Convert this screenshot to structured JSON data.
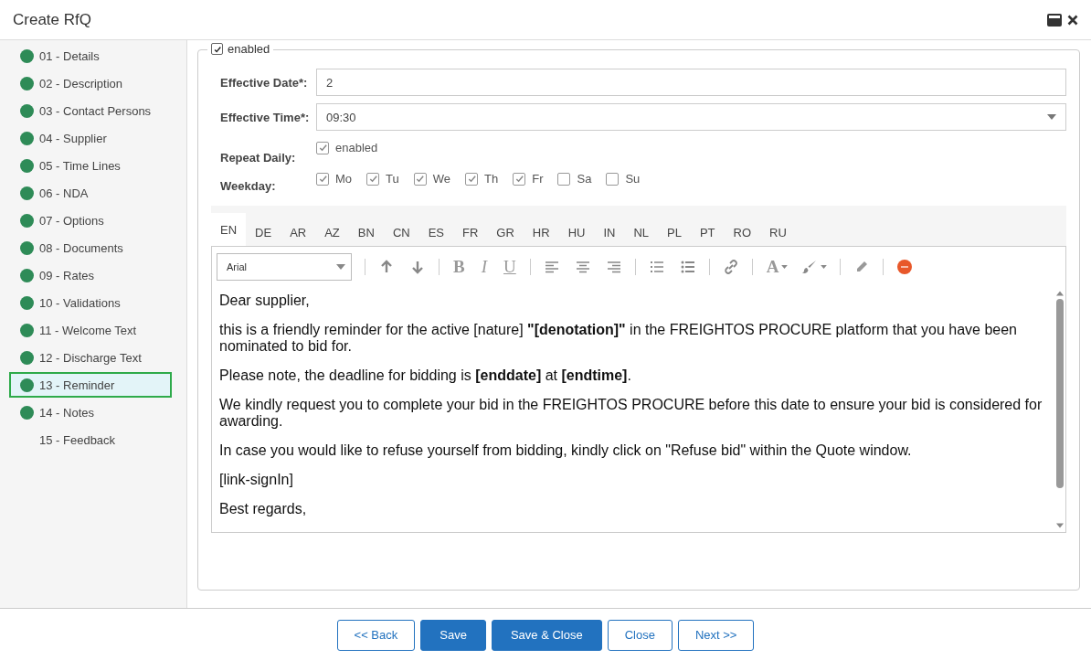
{
  "window": {
    "title": "Create RfQ"
  },
  "sidebar": {
    "items": [
      {
        "label": "01 - Details",
        "done": true,
        "selected": false
      },
      {
        "label": "02 - Description",
        "done": true,
        "selected": false
      },
      {
        "label": "03 - Contact Persons",
        "done": true,
        "selected": false
      },
      {
        "label": "04 - Supplier",
        "done": true,
        "selected": false
      },
      {
        "label": "05 - Time Lines",
        "done": true,
        "selected": false
      },
      {
        "label": "06 - NDA",
        "done": true,
        "selected": false
      },
      {
        "label": "07 - Options",
        "done": true,
        "selected": false
      },
      {
        "label": "08 - Documents",
        "done": true,
        "selected": false
      },
      {
        "label": "09 - Rates",
        "done": true,
        "selected": false
      },
      {
        "label": "10 - Validations",
        "done": true,
        "selected": false
      },
      {
        "label": "11 - Welcome Text",
        "done": true,
        "selected": false
      },
      {
        "label": "12 - Discharge Text",
        "done": true,
        "selected": false
      },
      {
        "label": "13 - Reminder",
        "done": true,
        "selected": true
      },
      {
        "label": "14 - Notes",
        "done": true,
        "selected": false
      },
      {
        "label": "15 - Feedback",
        "done": false,
        "selected": false
      }
    ]
  },
  "reminder": {
    "label": "enabled",
    "checked": true,
    "effective_date": {
      "label": "Effective Date*:",
      "value": "2"
    },
    "effective_time": {
      "label": "Effective Time*:",
      "value": "09:30"
    },
    "repeat_daily": {
      "label": "Repeat Daily:",
      "option": "enabled",
      "checked": true
    },
    "weekday": {
      "label": "Weekday:",
      "days": [
        {
          "label": "Mo",
          "checked": true
        },
        {
          "label": "Tu",
          "checked": true
        },
        {
          "label": "We",
          "checked": true
        },
        {
          "label": "Th",
          "checked": true
        },
        {
          "label": "Fr",
          "checked": true
        },
        {
          "label": "Sa",
          "checked": false
        },
        {
          "label": "Su",
          "checked": false
        }
      ]
    }
  },
  "languages": [
    {
      "label": "EN",
      "selected": true
    },
    {
      "label": "DE",
      "selected": false
    },
    {
      "label": "AR",
      "selected": false
    },
    {
      "label": "AZ",
      "selected": false
    },
    {
      "label": "BN",
      "selected": false
    },
    {
      "label": "CN",
      "selected": false
    },
    {
      "label": "ES",
      "selected": false
    },
    {
      "label": "FR",
      "selected": false
    },
    {
      "label": "GR",
      "selected": false
    },
    {
      "label": "HR",
      "selected": false
    },
    {
      "label": "HU",
      "selected": false
    },
    {
      "label": "IN",
      "selected": false
    },
    {
      "label": "NL",
      "selected": false
    },
    {
      "label": "PL",
      "selected": false
    },
    {
      "label": "PT",
      "selected": false
    },
    {
      "label": "RO",
      "selected": false
    },
    {
      "label": "RU",
      "selected": false
    }
  ],
  "toolbar": {
    "font": "Arial",
    "bold": "B",
    "italic": "I",
    "underline": "U",
    "font_color": "A"
  },
  "editor": {
    "paragraphs": [
      "Dear supplier,",
      "this is a friendly reminder for the active [nature] **\"[denotation]\"** in the FREIGHTOS PROCURE platform that you have been nominated to bid for.",
      "Please note, the deadline for bidding is **[enddate]** at **[endtime]**.",
      "We kindly request you to complete your bid in the FREIGHTOS PROCURE before this date to ensure your bid is considered for awarding.",
      "In case you would like to refuse yourself from bidding, kindly click on \"Refuse bid\" within the Quote window.",
      "[link-signIn]",
      "Best regards,"
    ]
  },
  "buttons": [
    {
      "label": "<< Back",
      "kind": "outline"
    },
    {
      "label": "Save",
      "kind": "primary"
    },
    {
      "label": "Save & Close",
      "kind": "primary"
    },
    {
      "label": "Close",
      "kind": "outline"
    },
    {
      "label": "Next >>",
      "kind": "outline"
    }
  ]
}
